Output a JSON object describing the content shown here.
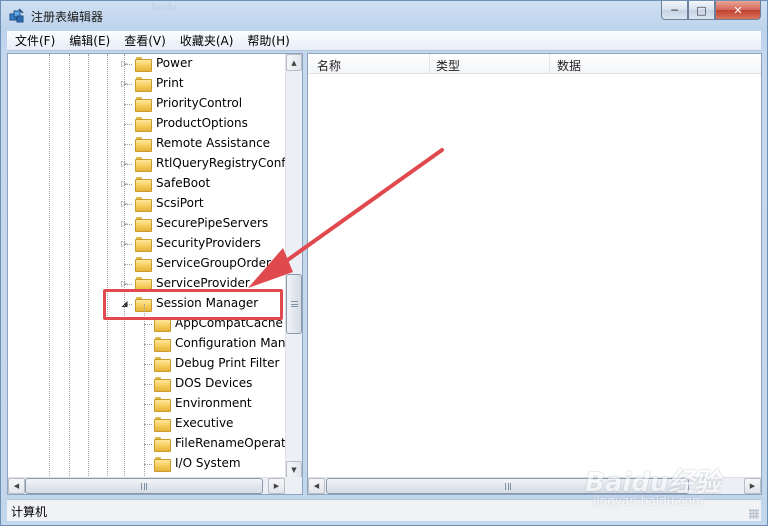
{
  "window": {
    "title": "注册表编辑器",
    "ghost_title": "Baidu"
  },
  "caption_buttons": {
    "minimize": "─",
    "maximize": "□",
    "close": "✕"
  },
  "menu": [
    "文件(F)",
    "编辑(E)",
    "查看(V)",
    "收藏夹(A)",
    "帮助(H)"
  ],
  "tree": {
    "nodes": [
      {
        "label": "Power",
        "expander": "collapsed",
        "level": 0
      },
      {
        "label": "Print",
        "expander": "collapsed",
        "level": 0
      },
      {
        "label": "PriorityControl",
        "expander": "none",
        "level": 0
      },
      {
        "label": "ProductOptions",
        "expander": "none",
        "level": 0
      },
      {
        "label": "Remote Assistance",
        "expander": "none",
        "level": 0
      },
      {
        "label": "RtlQueryRegistryConfig",
        "expander": "collapsed",
        "level": 0
      },
      {
        "label": "SafeBoot",
        "expander": "collapsed",
        "level": 0
      },
      {
        "label": "ScsiPort",
        "expander": "collapsed",
        "level": 0
      },
      {
        "label": "SecurePipeServers",
        "expander": "collapsed",
        "level": 0
      },
      {
        "label": "SecurityProviders",
        "expander": "collapsed",
        "level": 0
      },
      {
        "label": "ServiceGroupOrder",
        "expander": "none",
        "level": 0
      },
      {
        "label": "ServiceProvider",
        "expander": "collapsed",
        "level": 0
      },
      {
        "label": "Session Manager",
        "expander": "expanded",
        "level": 0
      },
      {
        "label": "AppCompatCache",
        "expander": "none",
        "level": 1
      },
      {
        "label": "Configuration Mana",
        "expander": "none",
        "level": 1
      },
      {
        "label": "Debug Print Filter",
        "expander": "none",
        "level": 1
      },
      {
        "label": "DOS Devices",
        "expander": "none",
        "level": 1
      },
      {
        "label": "Environment",
        "expander": "none",
        "level": 1
      },
      {
        "label": "Executive",
        "expander": "none",
        "level": 1
      },
      {
        "label": "FileRenameOperatio",
        "expander": "none",
        "level": 1
      },
      {
        "label": "I/O System",
        "expander": "none",
        "level": 1
      }
    ]
  },
  "list": {
    "columns": [
      "名称",
      "类型",
      "数据"
    ]
  },
  "status": {
    "text": "计算机"
  },
  "annotation": {
    "color": "#e04a4f"
  },
  "watermark": {
    "brand": "Baidu经验",
    "url": "jingyan.baidu.com"
  },
  "glyphs": {
    "collapsed": "▷",
    "expanded": "◢",
    "up": "▲",
    "down": "▼",
    "left": "◀",
    "right": "▶"
  }
}
